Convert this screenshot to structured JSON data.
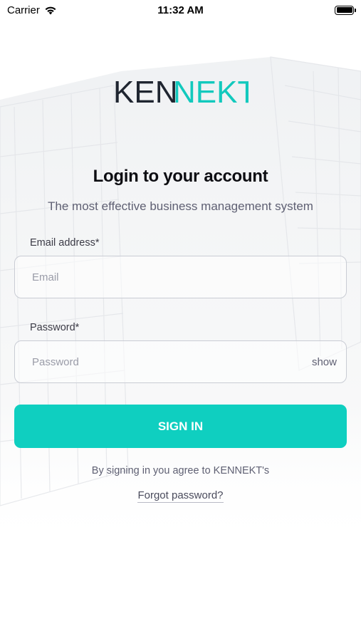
{
  "status_bar": {
    "carrier": "Carrier",
    "time": "11:32 AM"
  },
  "brand": {
    "logo_dark_part": "KEN",
    "logo_accent_part": "NEKT",
    "dark_color": "#1f2530",
    "accent_color": "#12c9bd"
  },
  "login": {
    "title": "Login to your account",
    "subtitle": "The most effective business management system",
    "email_label": "Email address*",
    "email_placeholder": "Email",
    "email_value": "",
    "password_label": "Password*",
    "password_placeholder": "Password",
    "password_value": "",
    "show_label": "show",
    "sign_in_label": "SIGN IN",
    "terms_text": "By signing in you agree to KENNEKT's",
    "forgot_label": "Forgot password?"
  },
  "colors": {
    "primary_button": "#0fcfc0",
    "text_muted": "#5f6073"
  },
  "icons": [
    "wifi-icon",
    "battery-icon"
  ]
}
